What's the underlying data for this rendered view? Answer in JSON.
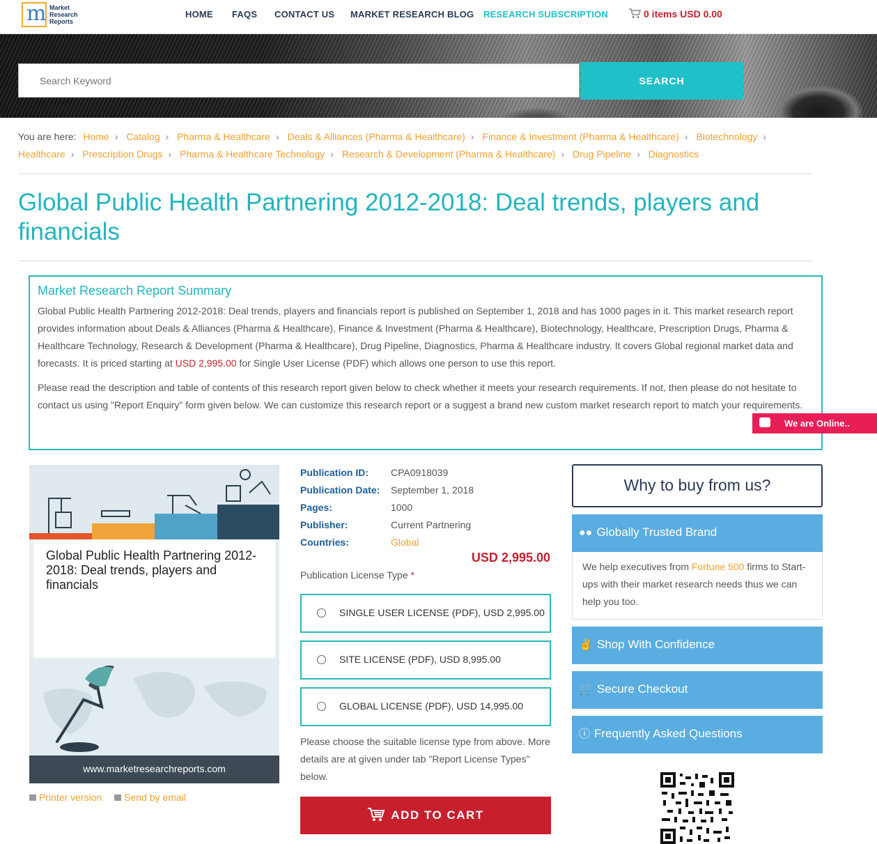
{
  "header": {
    "logo_lines": [
      "Market",
      "Research",
      "Reports"
    ],
    "nav": [
      "HOME",
      "FAQS",
      "CONTACT US",
      "MARKET RESEARCH BLOG",
      "RESEARCH SUBSCRIPTION"
    ],
    "cart_label": "0 items USD 0.00"
  },
  "search": {
    "placeholder": "Search Keyword",
    "button_label": "SEARCH"
  },
  "breadcrumb": {
    "prefix": "You are here:",
    "items": [
      "Home",
      "Catalog",
      "Pharma & Healthcare",
      "Deals & Alliances (Pharma & Healthcare)",
      "Finance & Investment (Pharma & Healthcare)",
      "Biotechnology",
      "Healthcare",
      "Prescription Drugs",
      "Pharma & Healthcare Technology",
      "Research & Development (Pharma & Healthcare)",
      "Drug Pipeline",
      "Diagnostics"
    ]
  },
  "page_title": "Global Public Health Partnering 2012-2018: Deal trends, players and financials",
  "summary": {
    "heading": "Market Research Report Summary",
    "p1_before_price": "Global Public Health Partnering 2012-2018: Deal trends, players and financials report is published on September 1, 2018 and has 1000 pages in it. This market research report provides information about Deals & Alliances (Pharma & Healthcare), Finance & Investment (Pharma & Healthcare), Biotechnology, Healthcare, Prescription Drugs, Pharma & Healthcare Technology, Research & Development (Pharma & Healthcare), Drug Pipeline, Diagnostics, Pharma & Healthcare industry. It covers Global regional market data and forecasts. It is priced starting at ",
    "p1_price": "USD 2,995.00",
    "p1_after_price": " for Single User License (PDF) which allows one person to use this report.",
    "p2": "Please read the description and table of contents of this research report given below to check whether it meets your research requirements. If not, then please do not hesitate to contact us using \"Report Enquiry\" form given below. We can customize this research report or a suggest a brand new custom market research report to match your requirements."
  },
  "chat_widget": {
    "label": "We are Online.."
  },
  "cover": {
    "title": "Global Public Health Partnering 2012-2018: Deal trends, players and financials",
    "url": "www.marketresearchreports.com"
  },
  "utilities": {
    "printer": "Printer version",
    "email": "Send by email"
  },
  "publication": {
    "id_label": "Publication ID:",
    "id": "CPA0918039",
    "date_label": "Publication Date:",
    "date": "September 1, 2018",
    "pages_label": "Pages:",
    "pages": "1000",
    "publisher_label": "Publisher:",
    "publisher": "Current Partnering",
    "countries_label": "Countries:",
    "countries": "Global",
    "price": "USD 2,995.00"
  },
  "license": {
    "label": "Publication License Type",
    "required_mark": "*",
    "options": [
      "SINGLE USER LICENSE (PDF), USD 2,995.00",
      "SITE LICENSE (PDF), USD 8,995.00",
      "GLOBAL LICENSE (PDF), USD 14,995.00"
    ],
    "hint": "Please choose the suitable license type from above. More details are at given under tab \"Report License Types\" below.",
    "add_to_cart": "ADD TO CART"
  },
  "sidebar": {
    "why_title": "Why to buy from us?",
    "panels": [
      "Globally Trusted Brand",
      "Shop With Confidence",
      "Secure Checkout",
      "Frequently Asked Questions"
    ],
    "trusted_before": "We help executives from ",
    "trusted_highlight": "Fortune 500",
    "trusted_after": " firms to Start-ups with their market research needs thus we can help you too."
  },
  "colors": {
    "accent": "#21c0c8",
    "price_red": "#c81f2d",
    "link_orange": "#f0a030",
    "panel_blue": "#5aade0",
    "chat_pink": "#e81f56"
  },
  "icons": [
    "cart-icon",
    "chat-icon",
    "users-icon",
    "thumbs-up-icon",
    "cart-icon",
    "question-circle-icon",
    "printer-icon",
    "email-icon",
    "qr-code"
  ]
}
